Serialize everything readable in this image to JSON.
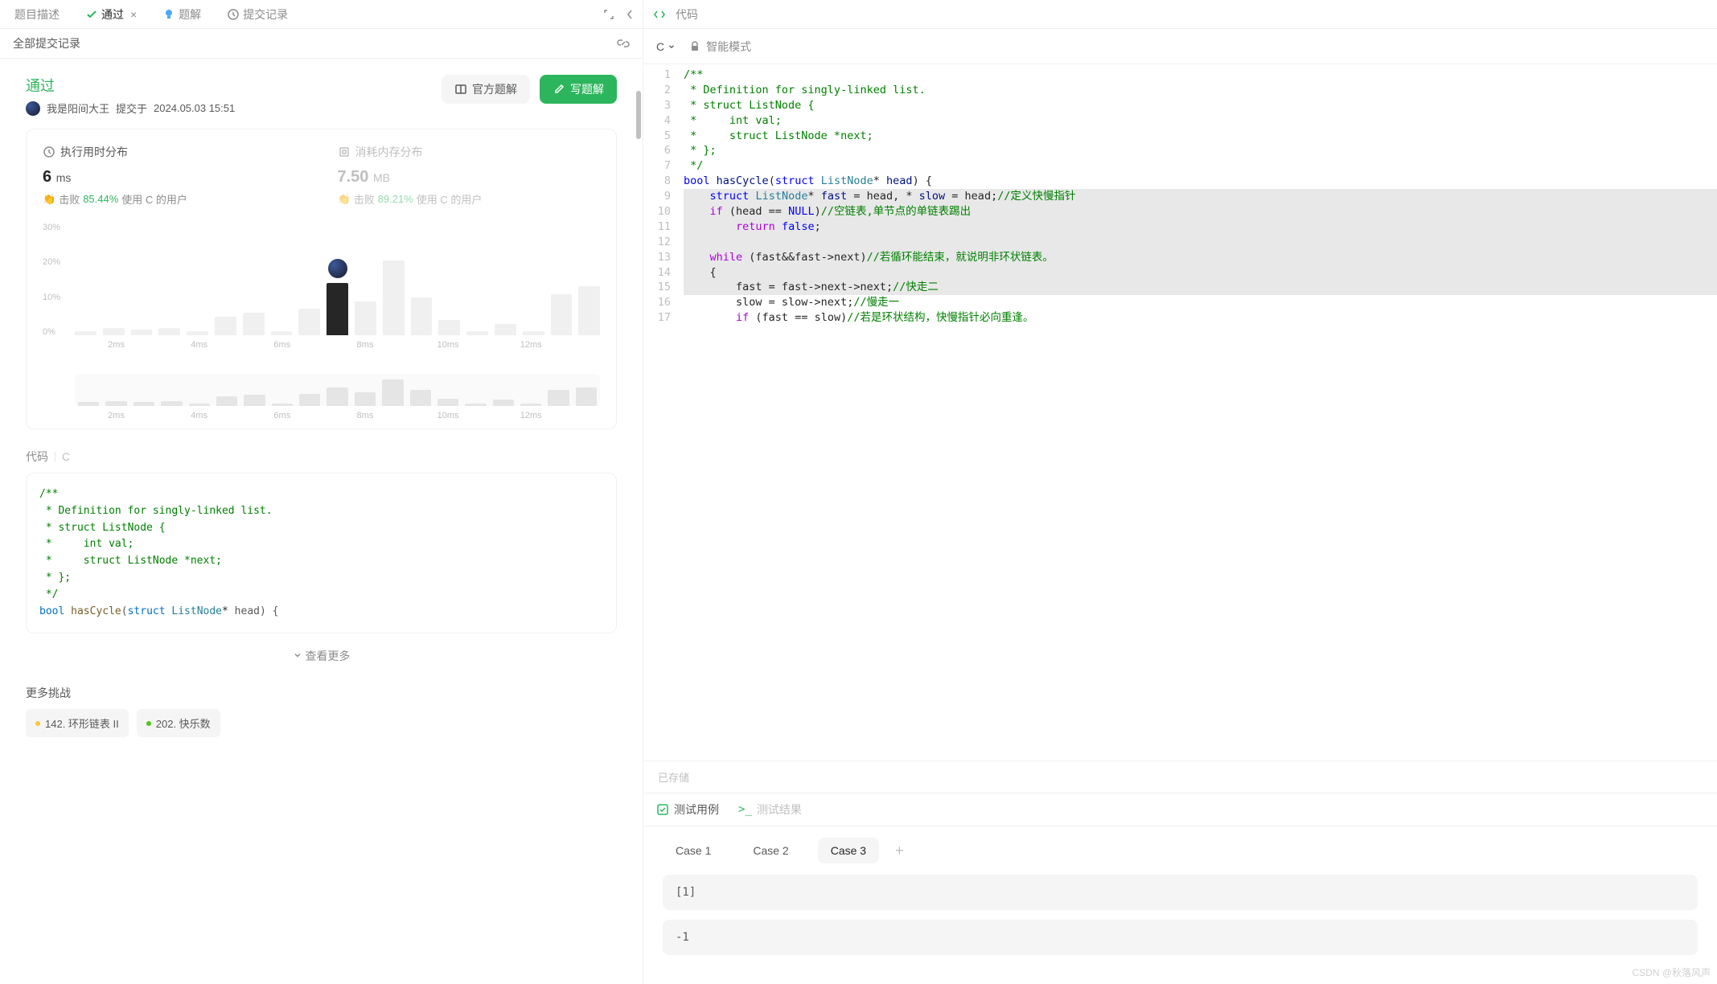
{
  "top_tabs": {
    "desc": "题目描述",
    "pass": "通过",
    "solution": "题解",
    "history": "提交记录"
  },
  "sub_header": "全部提交记录",
  "status": {
    "title": "通过",
    "user": "我是阳间大王",
    "submitted_prefix": "提交于",
    "submitted_at": "2024.05.03 15:51"
  },
  "actions": {
    "official": "官方题解",
    "write": "写题解"
  },
  "stats": {
    "time": {
      "label": "执行用时分布",
      "value": "6",
      "unit": "ms",
      "beat_prefix": "击败",
      "beat_pct": "85.44%",
      "beat_suffix": "使用 C 的用户"
    },
    "mem": {
      "label": "消耗内存分布",
      "value": "7.50",
      "unit": "MB",
      "beat_prefix": "击败",
      "beat_pct": "89.21%",
      "beat_suffix": "使用 C 的用户"
    }
  },
  "chart_data": {
    "type": "bar",
    "ylabel": "%",
    "ylim": [
      0,
      30
    ],
    "yticks": [
      "30%",
      "20%",
      "10%",
      "0%"
    ],
    "xticks": [
      "2ms",
      "4ms",
      "6ms",
      "8ms",
      "10ms",
      "12ms"
    ],
    "bars": [
      1,
      2,
      1.5,
      2,
      1,
      5,
      6,
      1,
      7,
      14,
      9,
      20,
      10,
      4,
      1,
      3,
      1,
      11,
      13
    ],
    "highlight_index": 9,
    "mini_bars": [
      3,
      4,
      3,
      4,
      2,
      8,
      9,
      2,
      10,
      15,
      11,
      22,
      13,
      6,
      2,
      5,
      2,
      13,
      15
    ]
  },
  "code_section": {
    "label": "代码",
    "lang": "C",
    "see_more": "查看更多"
  },
  "code_left": [
    "/**",
    " * Definition for singly-linked list.",
    " * struct ListNode {",
    " *     int val;",
    " *     struct ListNode *next;",
    " * };",
    " */",
    "bool hasCycle(struct ListNode* head) {"
  ],
  "more_section": "更多挑战",
  "chips": [
    {
      "color": "y",
      "text": "142. 环形链表 II"
    },
    {
      "color": "g",
      "text": "202. 快乐数"
    }
  ],
  "right_header": "代码",
  "lang_selector": "C",
  "smart_mode": "智能模式",
  "editor_lines": [
    {
      "n": 1,
      "html": "<span class='c-cm'>/**</span>"
    },
    {
      "n": 2,
      "html": "<span class='c-cm'> * Definition for singly-linked list.</span>"
    },
    {
      "n": 3,
      "html": "<span class='c-cm'> * struct ListNode {</span>"
    },
    {
      "n": 4,
      "html": "<span class='c-cm'> *     int val;</span>"
    },
    {
      "n": 5,
      "html": "<span class='c-cm'> *     struct ListNode *next;</span>"
    },
    {
      "n": 6,
      "html": "<span class='c-cm'> * };</span>"
    },
    {
      "n": 7,
      "html": "<span class='c-cm'> */</span>"
    },
    {
      "n": 8,
      "html": "<span class='c-kw'>bool</span> <span class='c-id'>hasCycle</span>(<span class='c-kw'>struct</span> <span class='c-ty'>ListNode</span>* <span class='c-id'>head</span>) {"
    },
    {
      "n": 9,
      "hl": true,
      "html": "    <span class='c-kw'>struct</span> <span class='c-ty'>ListNode</span>* <span class='c-id'>fast</span> = head, * <span class='c-id'>slow</span> = head;<span class='c-cm'>//定义快慢指针</span>"
    },
    {
      "n": 10,
      "hl": true,
      "html": "    <span class='c-kw2'>if</span> (head == <span class='c-null'>NULL</span>)<span class='c-cm'>//空链表,单节点的单链表踢出</span>"
    },
    {
      "n": 11,
      "hl": true,
      "html": "        <span class='c-kw2'>return</span> <span class='c-kw'>false</span>;"
    },
    {
      "n": 12,
      "hl": true,
      "html": " "
    },
    {
      "n": 13,
      "hl": true,
      "html": "    <span class='c-kw2'>while</span> (fast&&fast-&gt;next)<span class='c-cm'>//若循环能结束，就说明非环状链表。</span>"
    },
    {
      "n": 14,
      "hl": true,
      "html": "    {"
    },
    {
      "n": 15,
      "hl": true,
      "html": "        fast = fast-&gt;next-&gt;next;<span class='c-cm'>//快走二</span>"
    },
    {
      "n": 16,
      "html": "        slow = slow-&gt;next;<span class='c-cm'>//慢走一</span>"
    },
    {
      "n": 17,
      "html": "        <span class='c-kw2'>if</span> (fast == slow)<span class='c-cm'>//若是环状结构，快慢指针必向重逢。</span>"
    }
  ],
  "saved": "已存储",
  "test": {
    "cases_tab": "测试用例",
    "result_tab": "测试结果",
    "cases": [
      "Case 1",
      "Case 2",
      "Case 3"
    ],
    "active": 2,
    "input1": "[1]",
    "input2": "-1"
  },
  "watermark": "CSDN @秋落风声"
}
